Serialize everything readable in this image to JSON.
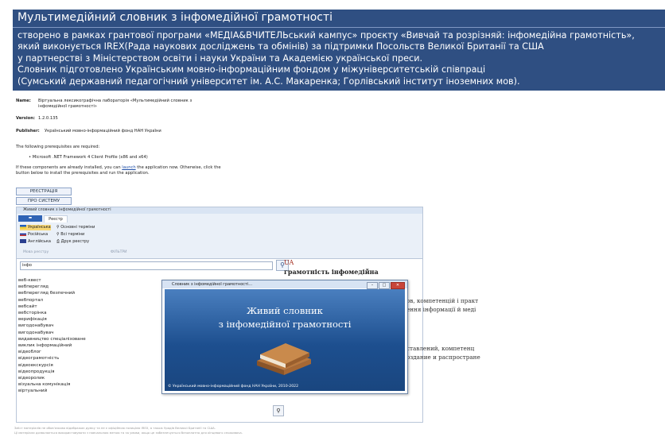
{
  "banner": {
    "title": "Мультимедійний словник з інфомедійної грамотності",
    "lines": [
      "створено в рамках грантової програми «МЕДІА&ВЧИТЕЛЬський кампус» проєкту «Вивчай та розрізняй: інфомедійна грамотність»,",
      "який виконується IREX(Рада наукових досліджень та обмінів) за підтримки Посольств Великої Британії та США",
      "у партнерстві з Міністерством освіти і науки України та Академією української преси.",
      "Словник підготовлено Українським мовно-інформаційним фондом у міжуніверситетській співпраці",
      "(Сумський державний педагогічний університет ім. А.С. Макаренка; Горлівський інститут іноземних мов)."
    ]
  },
  "install": {
    "name_label": "Name:",
    "name_line1": "Віртуальна лексикографічна лабораторія «Мультимедійний словник з",
    "name_line2": "інфомедійної грамотності»",
    "version_label": "Version:",
    "version_value": "1.2.0.135",
    "publisher_label": "Publisher:",
    "publisher_value": "Український мовно-інформаційний фонд НАН України",
    "prereq_intro": "The following prerequisites are required:",
    "prereq_item": "Microsoft .NET Framework 4 Client Profile (x86 and x64)",
    "launch_pre": "If these components are already installed, you can ",
    "launch_link": "launch",
    "launch_post": " the application now. Otherwise, click the",
    "launch_line2": "button below to install the prerequisites and run the application."
  },
  "buttons": {
    "register": "РЕЄСТРАЦІЯ",
    "about": "ПРО СИСТЕМУ"
  },
  "app": {
    "title": "Живий словник з інфомедійної грамотності",
    "file_tab": "▬",
    "registry_tab": "Реєстр",
    "languages": [
      "Українська",
      "Російська",
      "Англійська"
    ],
    "lang_group": "Мова реєстру",
    "filters": [
      "Основні терміни",
      "Всі терміни",
      "Друк реєстру"
    ],
    "filter_group": "ФІЛЬТРИ",
    "search_value": "інфо",
    "words": [
      "веб-квест",
      "вебперегляд",
      "вебперегляд безпечний",
      "вебпортал",
      "вебсайт",
      "вебсторінка",
      "верифікація",
      "вигодонабувач",
      "вигодонабувач",
      "видавництво спеціалізоване",
      "виклик інформаційний",
      "відеоблог",
      "відеограмотність",
      "відеоекскурсія",
      "відеопродукція",
      "відеоролик",
      "візуальна комунікація",
      "віртуальний"
    ],
    "lang_code": "UA",
    "term": "грамотність інфомедійна",
    "def_fragments": [
      "ов, компетенцій і практ",
      "ення інформації й меді",
      "ставлений, компетенц",
      "оздание и распростране"
    ],
    "splash": {
      "window_title": "Словник з інфомедійної грамотності...",
      "line1": "Живий словник",
      "line2": "з інфомедійної грамотності",
      "copyright": "© Український мовно-інформаційний фонд НАН України, 2010-2022"
    }
  },
  "footer": {
    "line1": "Зміст матеріалів не обов'язково відображає думку та не є офіційною позицією IREX, а також Урядів Великої Британії та США.",
    "line2": "Ці матеріали дозволяється використовувати з навчальною метою та за умови, якщо це забезпечується безоплатно для кінцевого споживача."
  },
  "colors": {
    "banner_bg": "#2f4f82",
    "accent": "#a1291a",
    "splash_bg": "#1d4f8f"
  }
}
